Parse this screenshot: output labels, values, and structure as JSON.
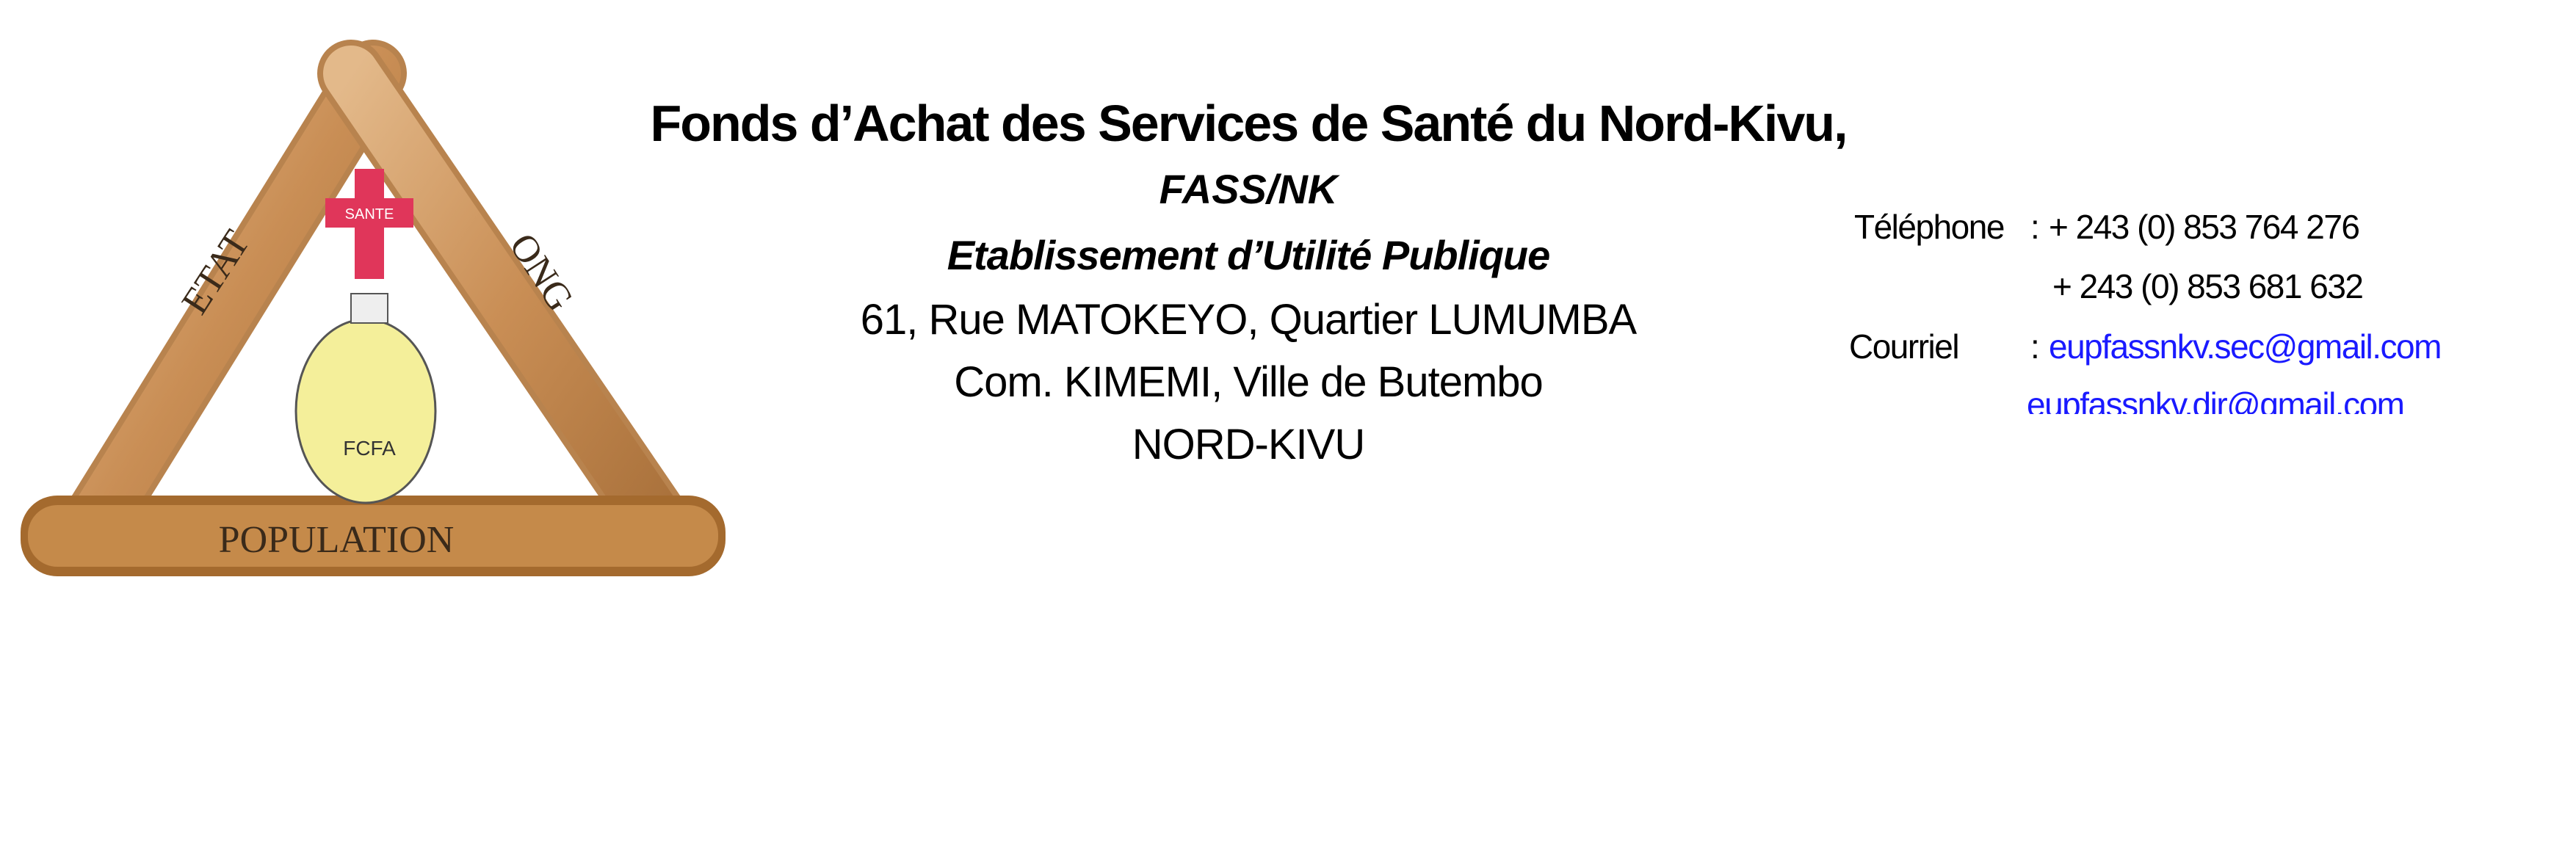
{
  "logo": {
    "labels": [
      "ETAT",
      "ONG",
      "POPULATION",
      "SANTE",
      "FCFA"
    ]
  },
  "header": {
    "title": "Fonds d’Achat des Services de Santé du Nord-Kivu,",
    "acronym": "FASS/NK",
    "status": "Etablissement d’Utilité Publique",
    "address": [
      "61, Rue MATOKEYO, Quartier LUMUMBA",
      "Com. KIMEMI, Ville de Butembo",
      "NORD-KIVU"
    ]
  },
  "contact": {
    "phone_label": "Téléphone",
    "separator": ":",
    "phones": [
      "+ 243 (0) 853 764 276",
      "+ 243 (0) 853 681 632"
    ],
    "email_label": "Courriel",
    "emails": [
      "eupfassnkv.sec@gmail.com",
      "eupfassnkv.dir@gmail.com"
    ],
    "link_color": "#1a1aff"
  }
}
